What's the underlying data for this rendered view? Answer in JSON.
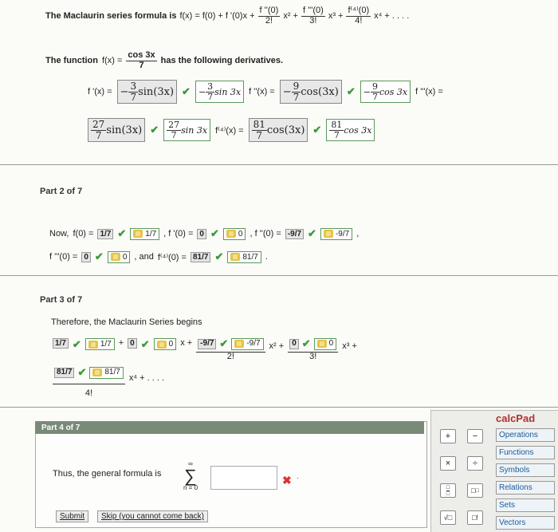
{
  "formula_intro": "The Maclaurin series formula is",
  "formula": {
    "lhs": "f(x) = f(0) + f '(0)x +",
    "t2num": "f ''(0)",
    "t2den": "2!",
    "t2pow": "x²  +",
    "t3num": "f '''(0)",
    "t3den": "3!",
    "t3pow": "x³  +",
    "t4num": "f⁽⁴⁾(0)",
    "t4den": "4!",
    "t4pow": "x⁴ + . . . ."
  },
  "function_intro": {
    "pre": "The function",
    "fx": "f(x) =",
    "num": "cos 3x",
    "den": "7",
    "post": "has the following derivatives."
  },
  "derivs": {
    "d1_label": "f '(x) =",
    "d1_ans": "−",
    "d1_num": "3",
    "d1_den": "7",
    "d1_fn": "sin(3x)",
    "d1_entry_num": "3",
    "d1_entry_den": "7",
    "d1_entry_fn": "sin 3x",
    "d2_label": "f ''(x) =",
    "d2_ans": "−",
    "d2_num": "9",
    "d2_den": "7",
    "d2_fn": "cos(3x)",
    "d2_entry_num": "9",
    "d2_entry_den": "7",
    "d2_entry_fn": "cos 3x",
    "d3_label": "f '''(x) =",
    "d3_num": "27",
    "d3_den": "7",
    "d3_fn": "sin(3x)",
    "d3_entry_num": "27",
    "d3_entry_den": "7",
    "d3_entry_fn": "sin 3x",
    "d4_label": "f⁽⁴⁾(x) =",
    "d4_num": "81",
    "d4_den": "7",
    "d4_fn": "cos(3x)",
    "d4_entry_num": "81",
    "d4_entry_den": "7",
    "d4_entry_fn": "cos 3x"
  },
  "part2": {
    "label": "Part 2 of 7",
    "now": "Now,",
    "f0": "f(0) =",
    "f0_val": "1/7",
    "f0_entry": "1/7",
    "f1": ", f '(0) =",
    "f1_val": "0",
    "f1_entry": "0",
    "f2": ", f ''(0) =",
    "f2_val": "-9/7",
    "f2_entry": "-9/7",
    "f3": "f '''(0) =",
    "f3_val": "0",
    "f3_entry": "0",
    "and": ", and",
    "f4": "f⁽⁴⁾(0) =",
    "f4_val": "81/7",
    "f4_entry": "81/7",
    "comma": ",",
    "period": "."
  },
  "part3": {
    "label": "Part 3 of 7",
    "text": "Therefore, the Maclaurin Series begins",
    "c0": "1/7",
    "c0_entry": "1/7",
    "plus": "+",
    "c1": "0",
    "c1_entry": "0",
    "x_plus": "x +",
    "c2": "-9/7",
    "c2_entry": "-9/7",
    "c2_den": "2!",
    "x2": "x² +",
    "c3": "0",
    "c3_entry": "0",
    "c3_den": "3!",
    "x3": "x³ +",
    "c4": "81/7",
    "c4_entry": "81/7",
    "c4_den": "4!",
    "x4": "x⁴ + . . . ."
  },
  "part4": {
    "label": "Part 4 of 7",
    "text": "Thus, the general formula is",
    "sum_top": "∞",
    "sum_bottom": "n = 0",
    "submit": "Submit",
    "skip": "Skip (you cannot come back)"
  },
  "calcpad": {
    "title": "calcPad",
    "categories": [
      "Operations",
      "Functions",
      "Symbols",
      "Relations",
      "Sets",
      "Vectors"
    ],
    "buttons": [
      "+",
      "−",
      "×",
      "÷",
      "√□",
      "□!"
    ]
  }
}
